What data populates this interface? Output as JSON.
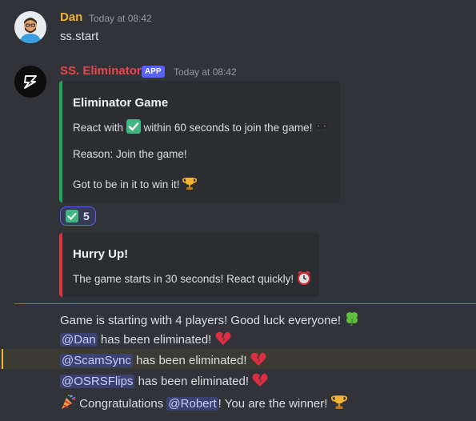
{
  "message1": {
    "username": "Dan",
    "username_color": "#f0b232",
    "timestamp": "Today at 08:42",
    "text": "ss.start"
  },
  "message2": {
    "username": "SS. Eliminator",
    "username_color": "#e5484d",
    "badge": "APP",
    "timestamp": "Today at 08:42",
    "embed1": {
      "accent": "#23a55a",
      "title": "Eliminator Game",
      "line1_a": "React with",
      "line1_b": "within 60 seconds to join the game!",
      "line2": "Reason: Join the game!",
      "line3": "Got to be in it to win it!"
    },
    "reaction": {
      "emoji": "check-mark-icon",
      "count": "5"
    },
    "embed2": {
      "accent": "#da373c",
      "title": "Hurry Up!",
      "line": "The game starts in 30 seconds! React quickly!"
    }
  },
  "new_divider_color": "#f23f43",
  "followups": {
    "start": "Game is starting with 4 players! Good luck everyone!",
    "elim1_mention": "@Dan",
    "elim2_mention": "@ScamSync",
    "elim3_mention": "@OSRSFlips",
    "elim_text": "has been eliminated!",
    "congrats_a": "Congratulations",
    "winner_mention": "@Robert",
    "congrats_b": "! You are the winner!"
  }
}
